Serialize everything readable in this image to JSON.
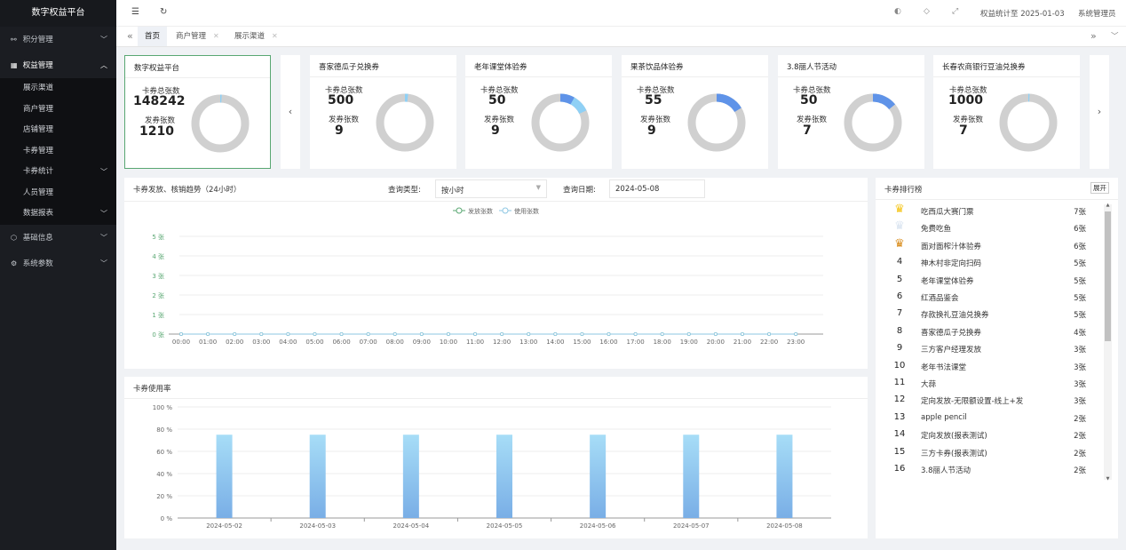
{
  "sidebar": {
    "logo": "数字权益平台",
    "points": "积分管理",
    "rights": "权益管理",
    "subs": [
      "展示渠道",
      "商户管理",
      "店铺管理",
      "卡券管理",
      "卡券统计",
      "人员管理",
      "数据报表"
    ],
    "basic": "基础信息",
    "params": "系统参数"
  },
  "header": {
    "stats_label": "权益统计至 2025-01-03",
    "user": "系统管理员"
  },
  "tabs": [
    "首页",
    "商户管理",
    "展示渠道"
  ],
  "cards": [
    {
      "title": "数字权益平台",
      "total_label": "卡券总张数",
      "total": "148242",
      "issued_label": "发券张数",
      "issued": "1210"
    },
    {
      "title": "喜家德瓜子兑换券",
      "total_label": "卡券总张数",
      "total": "500",
      "issued_label": "发券张数",
      "issued": "9"
    },
    {
      "title": "老年课堂体验券",
      "total_label": "卡券总张数",
      "total": "50",
      "issued_label": "发券张数",
      "issued": "9"
    },
    {
      "title": "果茶饮品体验券",
      "total_label": "卡券总张数",
      "total": "55",
      "issued_label": "发券张数",
      "issued": "9"
    },
    {
      "title": "3.8丽人节活动",
      "total_label": "卡券总张数",
      "total": "50",
      "issued_label": "发券张数",
      "issued": "7"
    },
    {
      "title": "长春农商银行豆油兑换券",
      "total_label": "卡券总张数",
      "total": "1000",
      "issued_label": "发券张数",
      "issued": "7"
    }
  ],
  "colors": {
    "accent": "#59a772",
    "sidebar": "#1b1d22",
    "donut_gray": "#d0d0d0",
    "donut_blue_light": "#8fd0f5",
    "donut_blue": "#5f93e8",
    "line_issue": "#59a772",
    "line_use": "#8ec7e3"
  },
  "trend": {
    "title": "卡券发放、核销趋势（24小时）",
    "query_type_label": "查询类型:",
    "query_type": "按小时",
    "query_date_label": "查询日期:",
    "query_date": "2024-05-08"
  },
  "usage": {
    "title": "卡券使用率"
  },
  "ranking": {
    "title": "卡券排行榜",
    "expand": "展开",
    "items": [
      {
        "rank": "1",
        "name": "吃西瓜大赛门票",
        "count": "7张"
      },
      {
        "rank": "2",
        "name": "免费吃鱼",
        "count": "6张"
      },
      {
        "rank": "3",
        "name": "面对面榨汁体验券",
        "count": "6张"
      },
      {
        "rank": "4",
        "name": "神木村非定向扫码",
        "count": "5张"
      },
      {
        "rank": "5",
        "name": "老年课堂体验券",
        "count": "5张"
      },
      {
        "rank": "6",
        "name": "红酒品鉴会",
        "count": "5张"
      },
      {
        "rank": "7",
        "name": "存款换礼豆油兑换券",
        "count": "5张"
      },
      {
        "rank": "8",
        "name": "喜家德瓜子兑换券",
        "count": "4张"
      },
      {
        "rank": "9",
        "name": "三方客户经理发放",
        "count": "3张"
      },
      {
        "rank": "10",
        "name": "老年书法课堂",
        "count": "3张"
      },
      {
        "rank": "11",
        "name": "大蒜",
        "count": "3张"
      },
      {
        "rank": "12",
        "name": "定向发放-无限额设置-线上+发",
        "count": "3张"
      },
      {
        "rank": "13",
        "name": "apple pencil",
        "count": "2张"
      },
      {
        "rank": "14",
        "name": "定向发放(报表测试)",
        "count": "2张"
      },
      {
        "rank": "15",
        "name": "三方卡券(报表测试)",
        "count": "2张"
      },
      {
        "rank": "16",
        "name": "3.8丽人节活动",
        "count": "2张"
      }
    ]
  },
  "chart_data": [
    {
      "type": "line",
      "title": "卡券发放、核销趋势（24小时）",
      "x": [
        "00:00",
        "01:00",
        "02:00",
        "03:00",
        "04:00",
        "05:00",
        "06:00",
        "07:00",
        "08:00",
        "09:00",
        "10:00",
        "11:00",
        "12:00",
        "13:00",
        "14:00",
        "15:00",
        "16:00",
        "17:00",
        "18:00",
        "19:00",
        "20:00",
        "21:00",
        "22:00",
        "23:00"
      ],
      "y_ticks": [
        "0 张",
        "1 张",
        "2 张",
        "3 张",
        "4 张",
        "5 张"
      ],
      "ylim": [
        0,
        5
      ],
      "legend_position": "top-center",
      "series": [
        {
          "name": "发放张数",
          "values": [
            0,
            0,
            0,
            0,
            0,
            0,
            0,
            0,
            0,
            0,
            0,
            0,
            0,
            0,
            0,
            0,
            0,
            0,
            0,
            0,
            0,
            0,
            0,
            0
          ]
        },
        {
          "name": "使用张数",
          "values": [
            0,
            0,
            0,
            0,
            0,
            0,
            0,
            0,
            0,
            0,
            0,
            0,
            0,
            0,
            0,
            0,
            0,
            0,
            0,
            0,
            0,
            0,
            0,
            0
          ]
        }
      ]
    },
    {
      "type": "bar",
      "title": "卡券使用率",
      "categories": [
        "2024-05-02",
        "2024-05-03",
        "2024-05-04",
        "2024-05-05",
        "2024-05-06",
        "2024-05-07",
        "2024-05-08"
      ],
      "values": [
        75,
        75,
        75,
        75,
        75,
        75,
        75
      ],
      "y_ticks": [
        "0 %",
        "20 %",
        "40 %",
        "60 %",
        "80 %",
        "100 %"
      ],
      "ylim": [
        0,
        100
      ]
    }
  ],
  "donuts": [
    {
      "ratio": 0.0082,
      "color": "#8fd0f5"
    },
    {
      "ratio": 0.018,
      "color": "#8fd0f5"
    },
    {
      "ratio": 0.18,
      "color": "#8fd0f5"
    },
    {
      "ratio": 0.164,
      "color": "#5f93e8"
    },
    {
      "ratio": 0.14,
      "color": "#5f93e8"
    },
    {
      "ratio": 0.007,
      "color": "#8fd0f5"
    }
  ]
}
